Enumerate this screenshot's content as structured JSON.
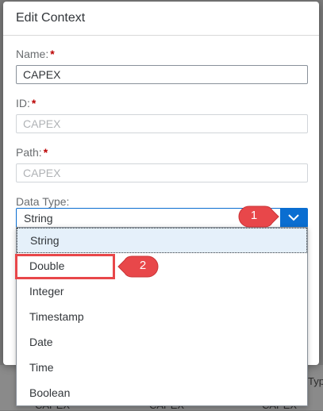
{
  "dialog": {
    "title": "Edit Context",
    "fields": {
      "name": {
        "label": "Name:",
        "required_mark": "*",
        "value": "CAPEX"
      },
      "id": {
        "label": "ID:",
        "required_mark": "*",
        "value": "CAPEX"
      },
      "path": {
        "label": "Path:",
        "required_mark": "*",
        "value": "CAPEX"
      },
      "data_type": {
        "label": "Data Type:",
        "value": "String"
      }
    }
  },
  "dropdown": {
    "options": [
      "String",
      "Double",
      "Integer",
      "Timestamp",
      "Date",
      "Time",
      "Boolean"
    ],
    "selected_index": 0
  },
  "annotations": {
    "callout_1": "1",
    "callout_2": "2"
  },
  "background": {
    "col1": "CAPEX",
    "col2": "CAPEX",
    "col3": "CAPEX",
    "col4": "Typ"
  },
  "colors": {
    "accent": "#0a6ed1",
    "annotation": "#e8474a",
    "required": "#bb0000"
  }
}
